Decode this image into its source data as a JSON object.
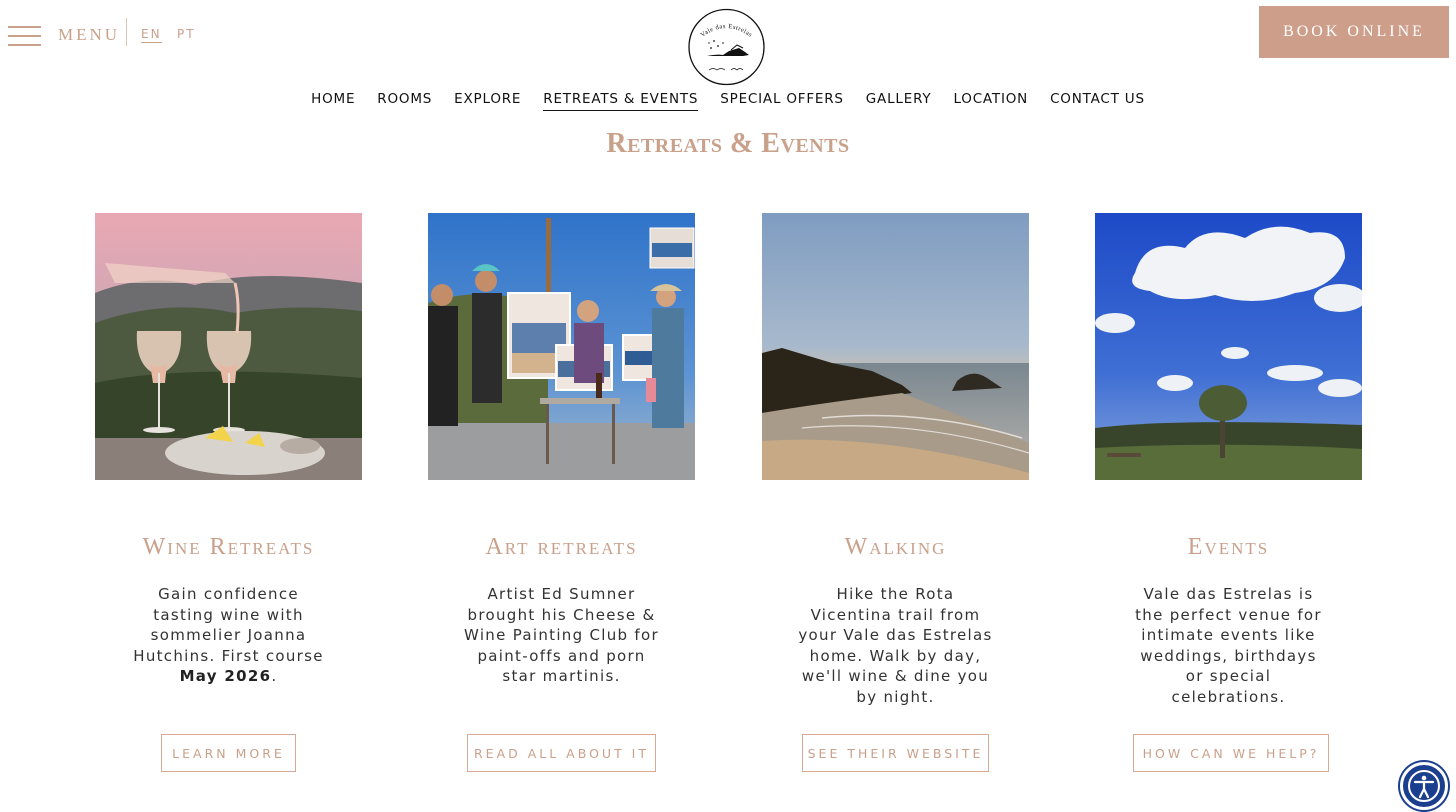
{
  "header": {
    "menu_label": "MENU",
    "lang_en": "EN",
    "lang_pt": "PT",
    "book_label": "BOOK ONLINE",
    "logo_text": "Vale das Estrelas",
    "menu_icon": "hamburger-icon"
  },
  "nav": {
    "items": [
      {
        "label": "HOME"
      },
      {
        "label": "ROOMS"
      },
      {
        "label": "EXPLORE"
      },
      {
        "label": "RETREATS & EVENTS",
        "active": true
      },
      {
        "label": "SPECIAL OFFERS"
      },
      {
        "label": "GALLERY"
      },
      {
        "label": "LOCATION"
      },
      {
        "label": "CONTACT US"
      }
    ]
  },
  "page": {
    "title": "Retreats & Events"
  },
  "cards": [
    {
      "title": "Wine Retreats",
      "body": "Gain confidence tasting wine with sommelier Joanna Hutchins. First course ",
      "body_bold": "May 2026",
      "body_end": ".",
      "button": "LEARN MORE"
    },
    {
      "title": "Art retreats",
      "body": "Artist Ed Sumner brought his Cheese & Wine Painting Club for paint-offs and porn star martinis.",
      "button": "READ ALL ABOUT IT"
    },
    {
      "title": "Walking",
      "body": "Hike the Rota Vicentina trail from your Vale das Estrelas home. Walk by day, we'll wine & dine you by night.",
      "button": "SEE THEIR WEBSITE"
    },
    {
      "title": "Events",
      "body": "Vale das Estrelas is the perfect venue for intimate events like weddings, birthdays or special celebrations.",
      "button": "HOW CAN WE HELP?"
    }
  ],
  "accessibility": {
    "icon": "accessibility-icon"
  },
  "colors": {
    "accent": "#c9a08a",
    "button_bg": "#cd9f8b",
    "a11y_bg": "#1b3f8f"
  }
}
